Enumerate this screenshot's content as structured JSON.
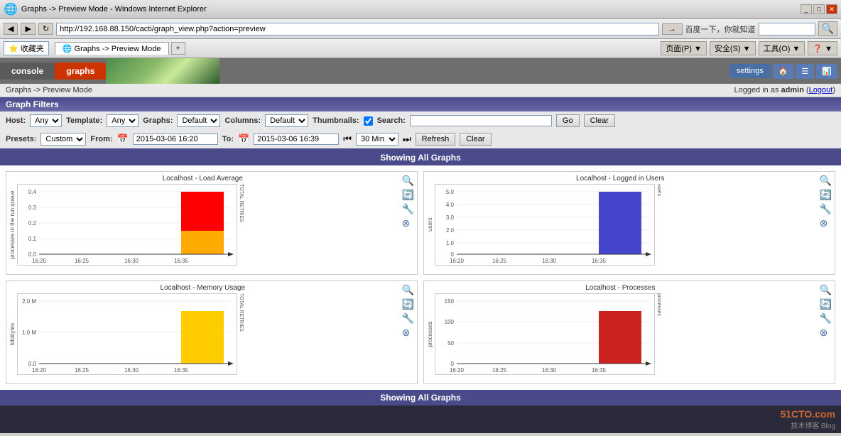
{
  "browser": {
    "title": "Graphs -> Preview Mode - Windows Internet Explorer",
    "url": "http://192.168.88.150/cacti/graph_view.php?action=preview",
    "tab_label": "Graphs -> Preview Mode"
  },
  "app": {
    "breadcrumb": "Graphs -> Preview Mode",
    "logged_in_text": "Logged in as",
    "logged_in_user": "admin",
    "logout_label": "Logout"
  },
  "nav": {
    "console_label": "console",
    "graphs_label": "graphs",
    "settings_label": "settings"
  },
  "filters": {
    "title": "Graph Filters",
    "host_label": "Host:",
    "host_value": "Any",
    "template_label": "Template:",
    "template_value": "Any",
    "graphs_label": "Graphs:",
    "graphs_value": "Default",
    "columns_label": "Columns:",
    "columns_value": "Default",
    "thumbnails_label": "Thumbnails:",
    "search_label": "Search:",
    "go_label": "Go",
    "clear_label": "Clear",
    "presets_label": "Presets:",
    "presets_value": "Custom",
    "from_label": "From:",
    "from_value": "2015-03-06 16:20",
    "to_label": "To:",
    "to_value": "2015-03-06 16:39",
    "timespan_value": "30 Min",
    "refresh_label": "Refresh",
    "clear2_label": "Clear"
  },
  "content": {
    "showing_label": "Showing All Graphs",
    "graphs": [
      {
        "id": "load-average",
        "title": "Localhost - Load Average",
        "ylabel": "processes in the run queue",
        "y_max": 0.4,
        "y_min": 0.0,
        "y_ticks": [
          0.0,
          0.1,
          0.2,
          0.3,
          0.4
        ],
        "x_labels": [
          "16:20",
          "16:25",
          "16:30",
          "16:35"
        ],
        "bars": [
          {
            "x": 0.78,
            "height": 0.55,
            "color": "#ff0000"
          },
          {
            "x": 0.78,
            "height": 0.25,
            "color": "#ffaa00"
          }
        ],
        "right_label": "TOTAL RETRIES"
      },
      {
        "id": "logged-in-users",
        "title": "Localhost - Logged in Users",
        "ylabel": "users",
        "y_max": 5.0,
        "y_ticks": [
          0.0,
          1.0,
          2.0,
          3.0,
          4.0,
          5.0
        ],
        "x_labels": [
          "16:20",
          "16:25",
          "16:30",
          "16:35"
        ],
        "bars": [
          {
            "x": 0.78,
            "height": 0.9,
            "color": "#4444cc"
          }
        ],
        "right_label": "users"
      },
      {
        "id": "memory-usage",
        "title": "Localhost - Memory Usage",
        "ylabel": "kilobytes",
        "y_max": "2.0 M",
        "y_ticks": [
          "0.0",
          "1.0 M",
          "2.0 M"
        ],
        "x_labels": [
          "16:20",
          "16:25",
          "16:30",
          "16:35"
        ],
        "bars": [
          {
            "x": 0.78,
            "height": 0.75,
            "color": "#ffcc00"
          }
        ],
        "right_label": "TOTAL RETRIES"
      },
      {
        "id": "processes",
        "title": "Localhost - Processes",
        "ylabel": "processes",
        "y_max": 150,
        "y_ticks": [
          0,
          50,
          100,
          150
        ],
        "x_labels": [
          "16:20",
          "16:25",
          "16:30",
          "16:35"
        ],
        "bars": [
          {
            "x": 0.78,
            "height": 0.75,
            "color": "#cc2222"
          }
        ],
        "right_label": "processes"
      }
    ]
  },
  "watermark": {
    "site": "51CTO.com",
    "sub": "技术博客 Blog"
  }
}
